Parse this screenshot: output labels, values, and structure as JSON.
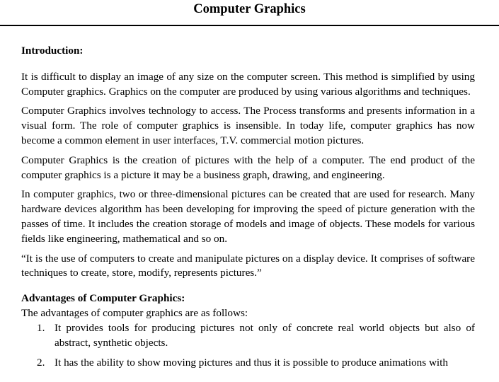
{
  "document": {
    "title": "Computer Graphics",
    "introduction": {
      "heading": "Introduction:",
      "paragraphs": [
        "It is difficult to display an image of any size on the computer screen. This method is simplified by using Computer graphics. Graphics on the computer are produced by using various algorithms and techniques.",
        "Computer Graphics involves technology to access. The Process transforms and presents information in a visual form. The role of computer graphics is insensible. In today life, computer graphics has now become a common element in user interfaces, T.V. commercial motion pictures.",
        "Computer Graphics is the creation of pictures with the help of a computer. The end product of the computer graphics is a picture it may be a business graph, drawing, and engineering.",
        "In computer graphics, two or three-dimensional pictures can be created that are used for research. Many hardware devices algorithm has been developing for improving the speed of picture generation with the passes of time. It includes the creation storage of models and image of objects. These models for various fields like engineering, mathematical and so on.",
        "“It is the use of computers to create and manipulate pictures on a display device. It comprises of software techniques to create, store, modify, represents pictures.”"
      ]
    },
    "advantages": {
      "heading": "Advantages of Computer Graphics:",
      "intro": "The advantages of computer graphics are as follows:",
      "items": [
        {
          "number": "1.",
          "text": "It provides tools for producing pictures not only of concrete real world objects but also of abstract, synthetic objects."
        },
        {
          "number": "2.",
          "text": "It has the ability to show moving pictures and thus it is possible to produce animations with"
        }
      ]
    }
  }
}
